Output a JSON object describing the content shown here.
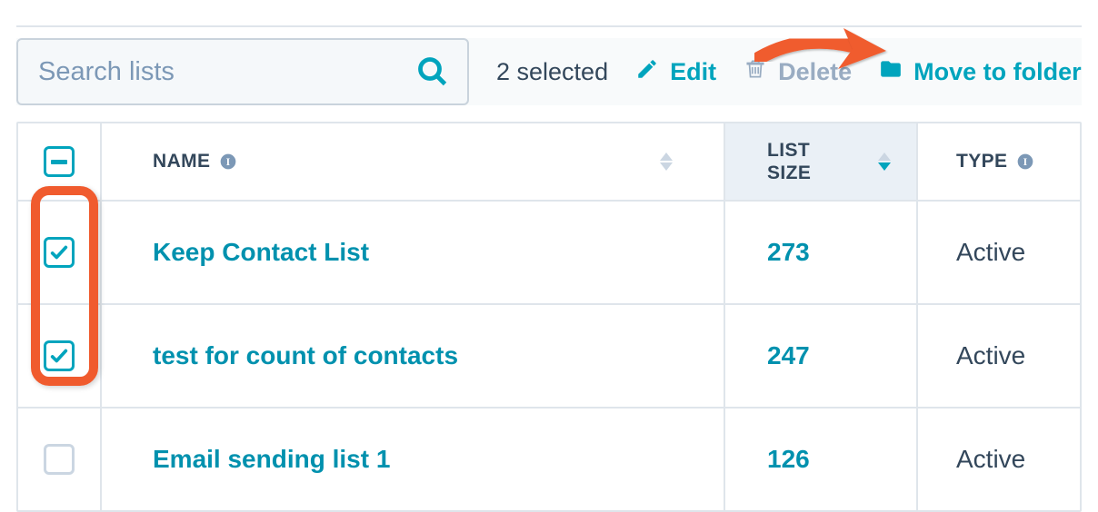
{
  "search": {
    "placeholder": "Search lists"
  },
  "toolbar": {
    "selected_label": "2 selected",
    "edit_label": "Edit",
    "delete_label": "Delete",
    "move_label": "Move to folder"
  },
  "columns": {
    "name": "Name",
    "size": "List Size",
    "type": "Type"
  },
  "rows": [
    {
      "checked": true,
      "name": "Keep Contact List",
      "size": "273",
      "type": "Active"
    },
    {
      "checked": true,
      "name": "test for count of contacts",
      "size": "247",
      "type": "Active"
    },
    {
      "checked": false,
      "name": "Email sending list 1",
      "size": "126",
      "type": "Active"
    }
  ],
  "colors": {
    "teal": "#00a4bd",
    "teal_dark": "#0091ae",
    "text_dark": "#33475b",
    "border": "#dfe5eb",
    "disabled": "#99acc2",
    "highlight": "#f05b2e"
  }
}
